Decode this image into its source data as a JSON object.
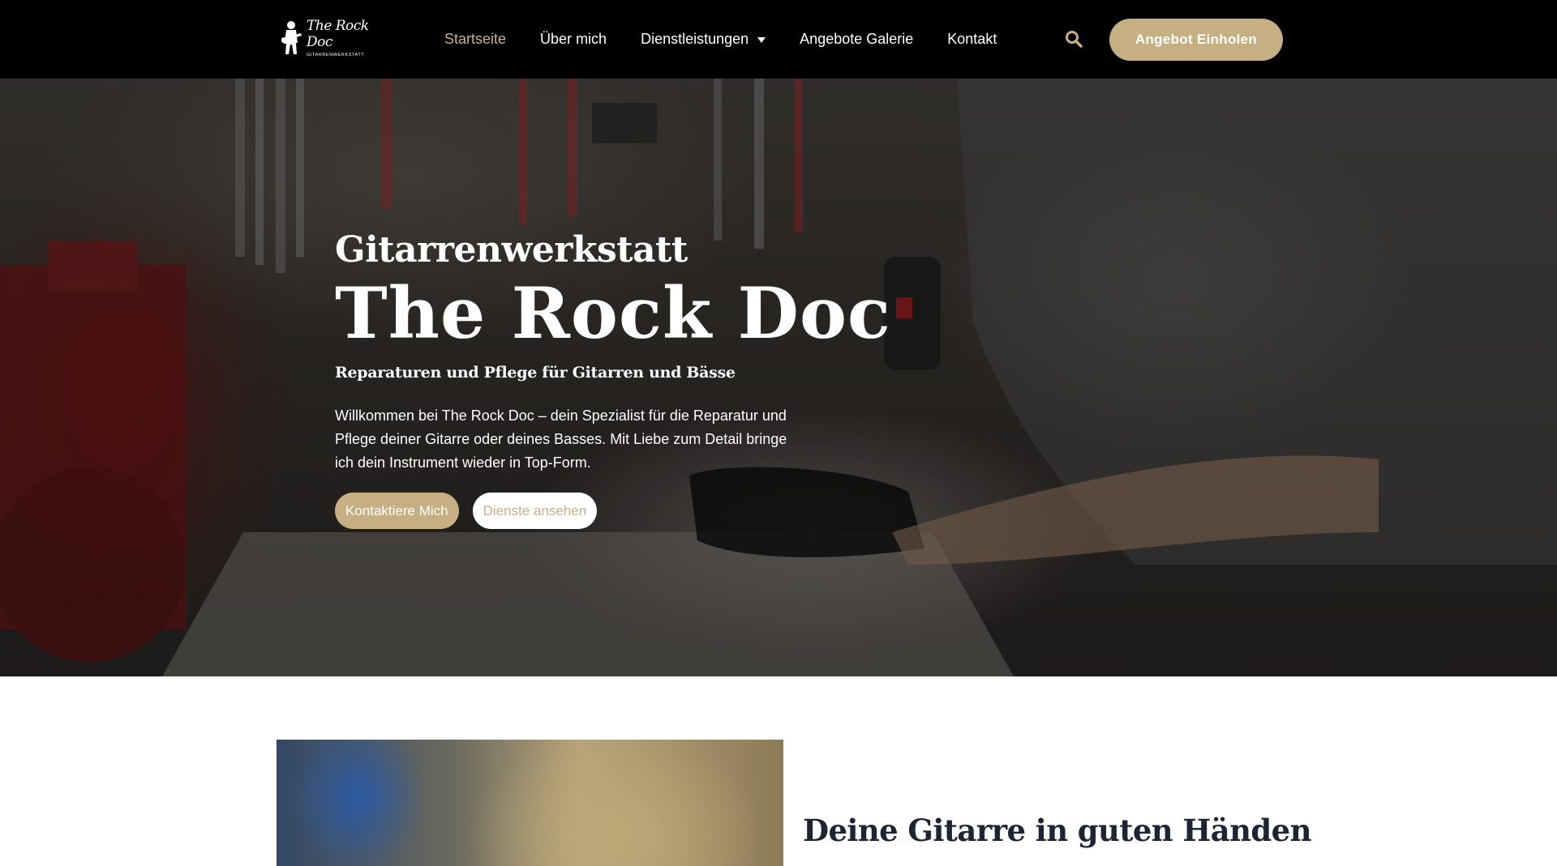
{
  "brand": {
    "logo_title": "The Rock Doc",
    "logo_subtitle": "GITARRENWERKSTATT"
  },
  "nav": {
    "items": [
      {
        "label": "Startseite",
        "active": true
      },
      {
        "label": "Über mich"
      },
      {
        "label": "Dienstleistungen",
        "has_dropdown": true
      },
      {
        "label": "Angebote Galerie"
      },
      {
        "label": "Kontakt"
      }
    ],
    "search_icon": "search-icon",
    "cta_label": "Angebot Einholen"
  },
  "hero": {
    "kicker": "Gitarrenwerkstatt",
    "title": "The Rock Doc",
    "subtitle": "Reparaturen und Pflege für Gitarren und Bässe",
    "text": "Willkommen bei The Rock Doc – dein Spezialist für die Reparatur und Pflege deiner Gitarre oder deines Basses. Mit Liebe zum Detail bringe ich dein Instrument wieder in Top-Form.",
    "primary_button": "Kontaktiere Mich",
    "secondary_button": "Dienste ansehen"
  },
  "section": {
    "title": "Deine Gitarre in guten Händen"
  },
  "colors": {
    "accent": "#c6b083",
    "header_bg": "#000000",
    "heading_dark": "#1d2433"
  }
}
